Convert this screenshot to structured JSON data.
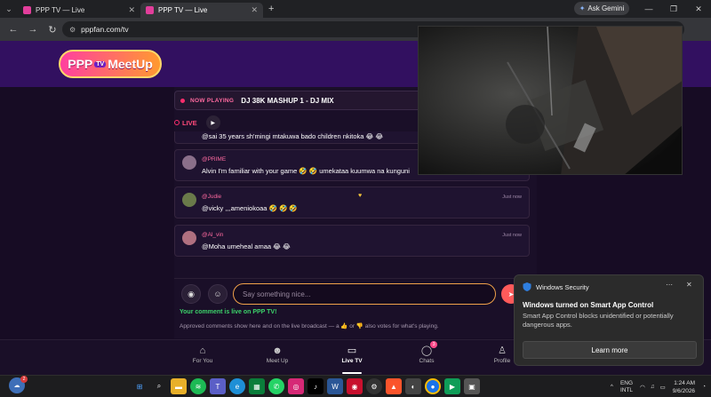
{
  "browser": {
    "tabs": [
      {
        "title": "PPP TV — Live"
      },
      {
        "title": "PPP TV — Live"
      }
    ],
    "ask_gemini": "Ask Gemini",
    "url": "pppfan.com/tv"
  },
  "site": {
    "logo_ppp": "PPP",
    "logo_tv": "TV",
    "logo_meetup": "MeetUp"
  },
  "now_playing": {
    "label": "NOW PLAYING",
    "title": "DJ 38K MASHUP 1 - DJ MIX",
    "live": "LIVE"
  },
  "messages": [
    {
      "user": "",
      "text": "@sai 35 years sh'mingi mtakuwa bado children nkitoka 😂 😂",
      "time": ""
    },
    {
      "user": "@PRIME",
      "text": "Alvin I'm familiar with your game 🤣 🤣 umekataa kuumwa na kunguni",
      "time": ""
    },
    {
      "user": "@Judie",
      "text": "@vicky ,,,ameniokoaa 🤣 🤣 🤣",
      "time": "Just now"
    },
    {
      "user": "@Al_vin",
      "text": "@Moha umeheal amaa 😂 😂",
      "time": "Just now"
    }
  ],
  "composer": {
    "placeholder": "Say something nice...",
    "live_notice": "Your comment is live on PPP TV!",
    "approve_note": "Approved comments show here and on the live broadcast — a 👍 or 👎 also votes for what's playing."
  },
  "nav": {
    "items": [
      {
        "label": "For You",
        "icon": "home-icon"
      },
      {
        "label": "Meet Up",
        "icon": "people-icon"
      },
      {
        "label": "Live TV",
        "icon": "tv-icon"
      },
      {
        "label": "Chats",
        "icon": "chat-icon",
        "badge": "3"
      },
      {
        "label": "Profile",
        "icon": "person-icon"
      }
    ],
    "active": "Live TV"
  },
  "toast": {
    "app": "Windows Security",
    "title": "Windows turned on Smart App Control",
    "body": "Smart App Control blocks unidentified or potentially dangerous apps.",
    "action": "Learn more"
  },
  "taskbar": {
    "weather_badge": "2",
    "lang_top": "ENG",
    "lang_bottom": "INTL",
    "time": "1:24 AM",
    "date": "9/6/2026"
  },
  "colors": {
    "header_bg": "#321060",
    "page_bg": "#170c24",
    "accent_pink": "#ff6aa0",
    "live_green": "#3cd36a",
    "input_border": "#f0a14a"
  }
}
